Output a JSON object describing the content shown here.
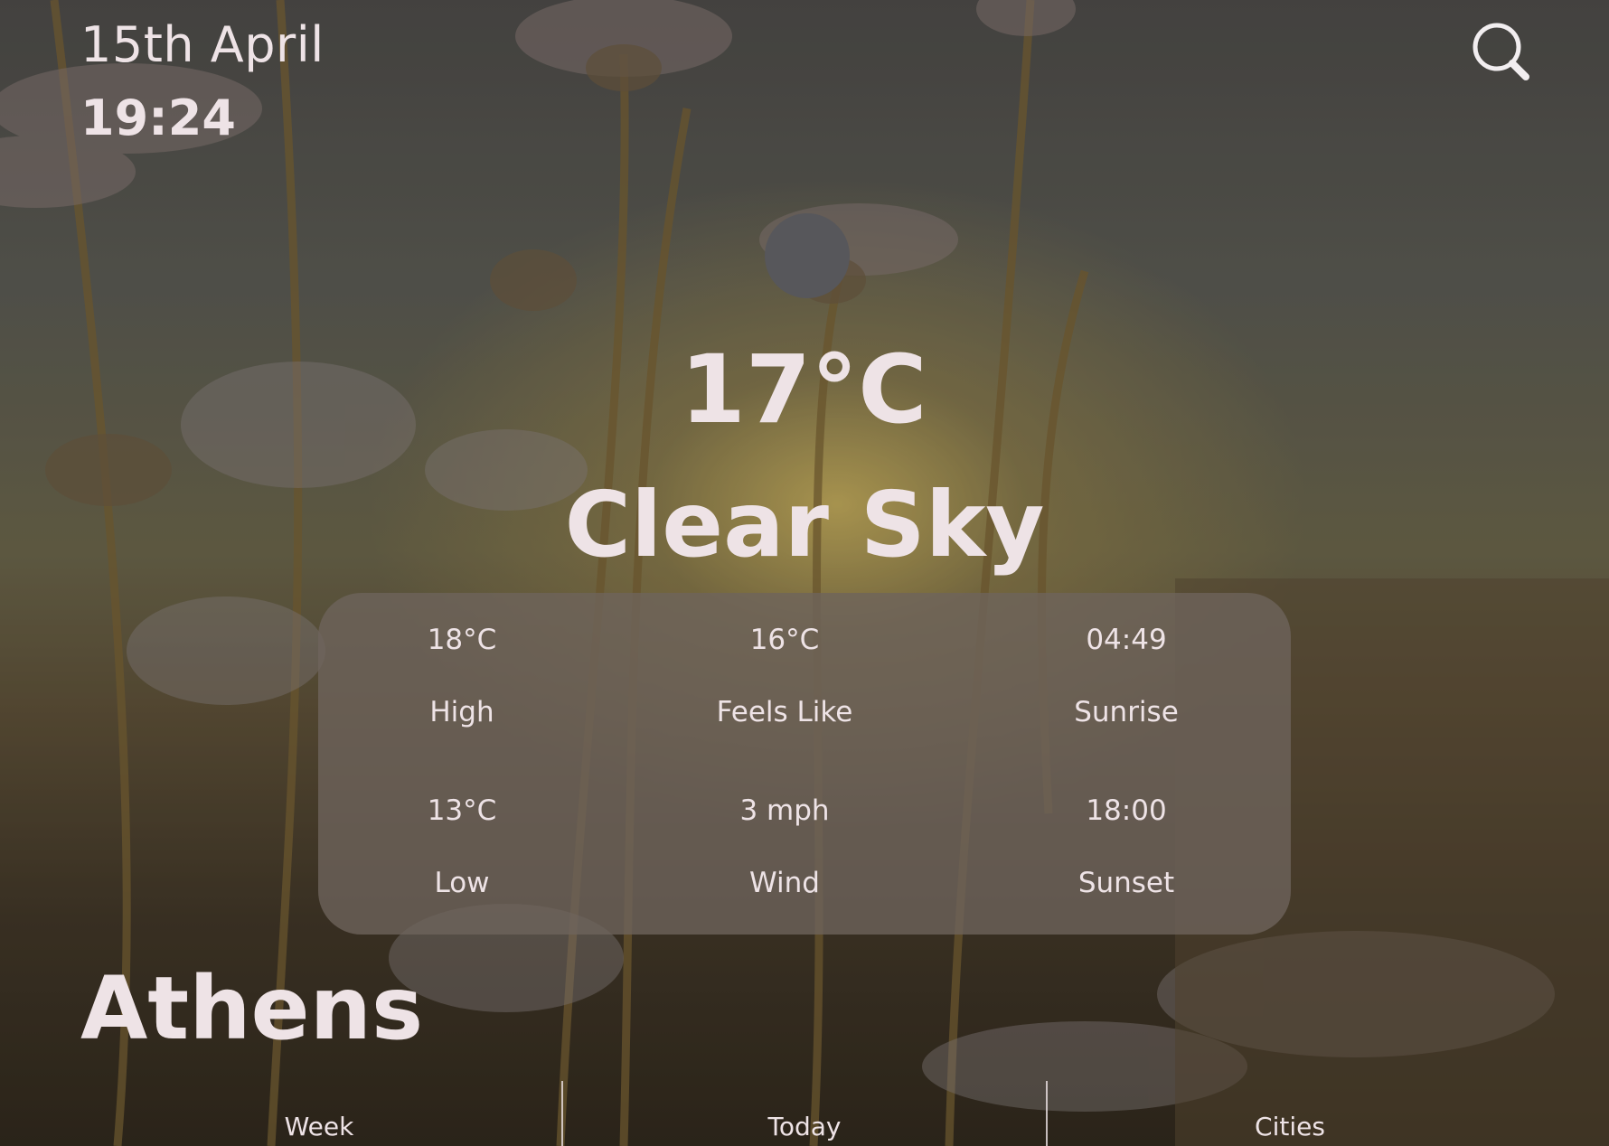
{
  "header": {
    "date": "15th April",
    "time": "19:24",
    "search_icon": "search-icon"
  },
  "current": {
    "weather_icon": "clear-sky-icon",
    "temperature": "17°C",
    "condition": "Clear Sky"
  },
  "stats": {
    "high": {
      "value": "18°C",
      "label": "High"
    },
    "feels_like": {
      "value": "16°C",
      "label": "Feels Like"
    },
    "sunrise": {
      "value": "04:49",
      "label": "Sunrise"
    },
    "low": {
      "value": "13°C",
      "label": "Low"
    },
    "wind": {
      "value": "3 mph",
      "label": "Wind"
    },
    "sunset": {
      "value": "18:00",
      "label": "Sunset"
    }
  },
  "location": {
    "city": "Athens"
  },
  "nav": {
    "items": [
      {
        "label": "Week"
      },
      {
        "label": "Today"
      },
      {
        "label": "Cities"
      }
    ]
  },
  "colors": {
    "text": "#eee3e6",
    "card": "#6e645c",
    "icon_placeholder": "#57575b"
  }
}
